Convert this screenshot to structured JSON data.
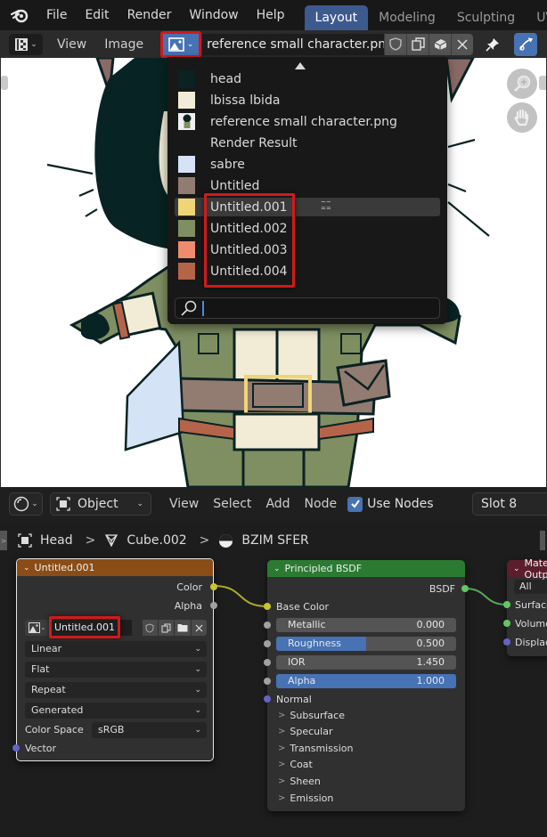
{
  "topbar": {
    "menus": [
      "File",
      "Edit",
      "Render",
      "Window",
      "Help"
    ],
    "workspaces": [
      {
        "label": "Layout",
        "active": true
      },
      {
        "label": "Modeling",
        "active": false
      },
      {
        "label": "Sculpting",
        "active": false
      },
      {
        "label": "UV Editing",
        "active": false
      }
    ]
  },
  "image_editor": {
    "menus": [
      "View",
      "Image"
    ],
    "image_name": "reference small character.png",
    "icons": [
      "fake-user-shield-icon",
      "duplicate-image-icon",
      "pack-image-icon",
      "unlink-icon",
      "pin-icon",
      "uv-sync-icon"
    ]
  },
  "image_browser": {
    "items": [
      {
        "label": "head",
        "swatch": "#0b2223"
      },
      {
        "label": "lbissa lbida",
        "swatch": "#f2ecd6"
      },
      {
        "label": "reference small character.png",
        "swatch": "thumbnail"
      },
      {
        "label": "Render Result",
        "swatch": ""
      },
      {
        "label": "sabre",
        "swatch": "#d4e3f5"
      },
      {
        "label": "Untitled",
        "swatch": "#927b70"
      },
      {
        "label": "Untitled.001",
        "swatch": "#f0d576",
        "highlighted": true
      },
      {
        "label": "Untitled.002",
        "swatch": "#7f8f62"
      },
      {
        "label": "Untitled.003",
        "swatch": "#f08c6e"
      },
      {
        "label": "Untitled.004",
        "swatch": "#b5644a"
      }
    ],
    "search_placeholder": "",
    "search_value": ""
  },
  "node_editor": {
    "editor_type": "Shader Editor",
    "mode": "Object",
    "menus": [
      "View",
      "Select",
      "Add",
      "Node"
    ],
    "use_nodes_label": "Use Nodes",
    "use_nodes_checked": true,
    "slot": "Slot 8",
    "breadcrumb": [
      {
        "label": "Head",
        "icon": "object-icon"
      },
      {
        "label": "Cube.002",
        "icon": "mesh-icon"
      },
      {
        "label": "BZIM SFER",
        "icon": "material-icon"
      }
    ]
  },
  "image_texture_node": {
    "title": "Untitled.001",
    "outputs": [
      "Color",
      "Alpha"
    ],
    "image_field": "Untitled.001",
    "interpolation": "Linear",
    "projection": "Flat",
    "extension": "Repeat",
    "source": "Generated",
    "color_space_label": "Color Space",
    "color_space": "sRGB",
    "input": "Vector"
  },
  "bsdf_node": {
    "title": "Principled BSDF",
    "output": "BSDF",
    "base_color_label": "Base Color",
    "sliders": [
      {
        "label": "Metallic",
        "value": "0.000",
        "fraction": 0.0
      },
      {
        "label": "Roughness",
        "value": "0.500",
        "fraction": 0.5
      },
      {
        "label": "IOR",
        "value": "1.450",
        "fraction": 0.0
      },
      {
        "label": "Alpha",
        "value": "1.000",
        "fraction": 1.0
      }
    ],
    "normal_label": "Normal",
    "panels": [
      "Subsurface",
      "Specular",
      "Transmission",
      "Coat",
      "Sheen",
      "Emission"
    ]
  },
  "material_output_node": {
    "title": "Material Output",
    "target": "All",
    "inputs": [
      "Surface",
      "Volume",
      "Displacement"
    ]
  },
  "colors": {
    "accent": "#4772b3",
    "highlight": "#d11a1a",
    "texture_header": "#8a4d16",
    "shader_header": "#2b7a32",
    "output_header": "#5a1f2b",
    "socket_color": "#c7c729",
    "socket_float": "#a1a1a1",
    "socket_vector": "#6363c7",
    "socket_shader": "#63c763"
  }
}
